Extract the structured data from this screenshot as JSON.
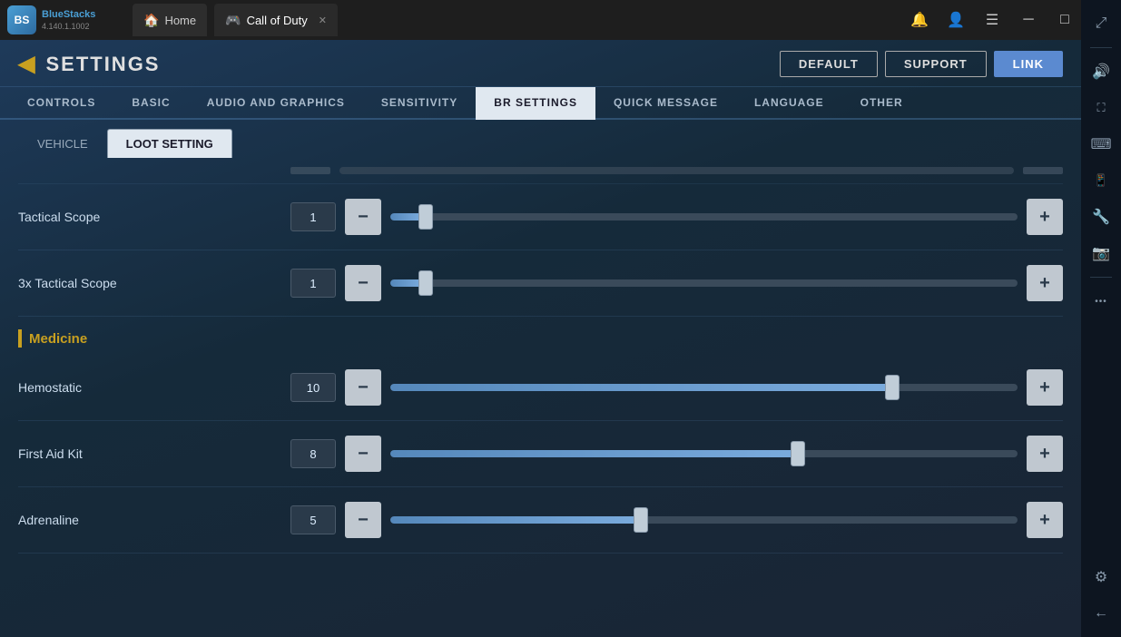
{
  "titlebar": {
    "app_name": "BlueStacks",
    "app_version": "4.140.1.1002",
    "tabs": [
      {
        "id": "home",
        "label": "Home",
        "icon_char": "🏠",
        "active": false
      },
      {
        "id": "cod",
        "label": "Call of Duty",
        "icon_char": "🎮",
        "active": true
      }
    ],
    "controls": {
      "notification": "🔔",
      "account": "👤",
      "menu": "☰",
      "minimize": "─",
      "maximize": "□",
      "close": "✕"
    }
  },
  "right_sidebar": {
    "buttons": [
      {
        "id": "expand",
        "icon": "⤢",
        "name": "expand-icon"
      },
      {
        "id": "volume",
        "icon": "🔊",
        "name": "volume-icon"
      },
      {
        "id": "fullscreen",
        "icon": "⛶",
        "name": "fullscreen-icon"
      },
      {
        "id": "keyboard",
        "icon": "⌨",
        "name": "keyboard-icon"
      },
      {
        "id": "mobile",
        "icon": "📱",
        "name": "mobile-icon"
      },
      {
        "id": "tools",
        "icon": "🔧",
        "name": "tools-icon"
      },
      {
        "id": "camera",
        "icon": "📷",
        "name": "camera-icon"
      },
      {
        "id": "more",
        "icon": "•••",
        "name": "more-icon"
      },
      {
        "id": "settings",
        "icon": "⚙",
        "name": "settings-icon"
      },
      {
        "id": "back",
        "icon": "←",
        "name": "back-icon"
      }
    ]
  },
  "settings": {
    "title": "SETTINGS",
    "header_buttons": [
      {
        "id": "default",
        "label": "DEFAULT",
        "active": false
      },
      {
        "id": "support",
        "label": "SUPPORT",
        "active": false
      },
      {
        "id": "link",
        "label": "LINK",
        "active": true
      }
    ],
    "tabs": [
      {
        "id": "controls",
        "label": "CONTROLS",
        "active": false
      },
      {
        "id": "basic",
        "label": "BASIC",
        "active": false
      },
      {
        "id": "audio_graphics",
        "label": "AUDIO AND GRAPHICS",
        "active": false
      },
      {
        "id": "sensitivity",
        "label": "SENSITIVITY",
        "active": false
      },
      {
        "id": "br_settings",
        "label": "BR SETTINGS",
        "active": true
      },
      {
        "id": "quick_message",
        "label": "QUICK MESSAGE",
        "active": false
      },
      {
        "id": "language",
        "label": "LANGUAGE",
        "active": false
      },
      {
        "id": "other",
        "label": "OTHER",
        "active": false
      }
    ],
    "sub_tabs": [
      {
        "id": "vehicle",
        "label": "VEHICLE",
        "active": false
      },
      {
        "id": "loot_setting",
        "label": "LOOT SETTING",
        "active": true
      }
    ],
    "sections": {
      "medicine": {
        "title": "Medicine",
        "items": [
          {
            "id": "hemostatic",
            "label": "Hemostatic",
            "value": 10,
            "fill_percent": 80
          },
          {
            "id": "first_aid_kit",
            "label": "First Aid Kit",
            "value": 8,
            "fill_percent": 65
          },
          {
            "id": "adrenaline",
            "label": "Adrenaline",
            "value": 5,
            "fill_percent": 40
          }
        ]
      }
    },
    "scope_items": [
      {
        "id": "tactical_scope",
        "label": "Tactical Scope",
        "value": 1,
        "fill_percent": 5
      },
      {
        "id": "3x_tactical_scope",
        "label": "3x Tactical Scope",
        "value": 1,
        "fill_percent": 5
      }
    ]
  }
}
